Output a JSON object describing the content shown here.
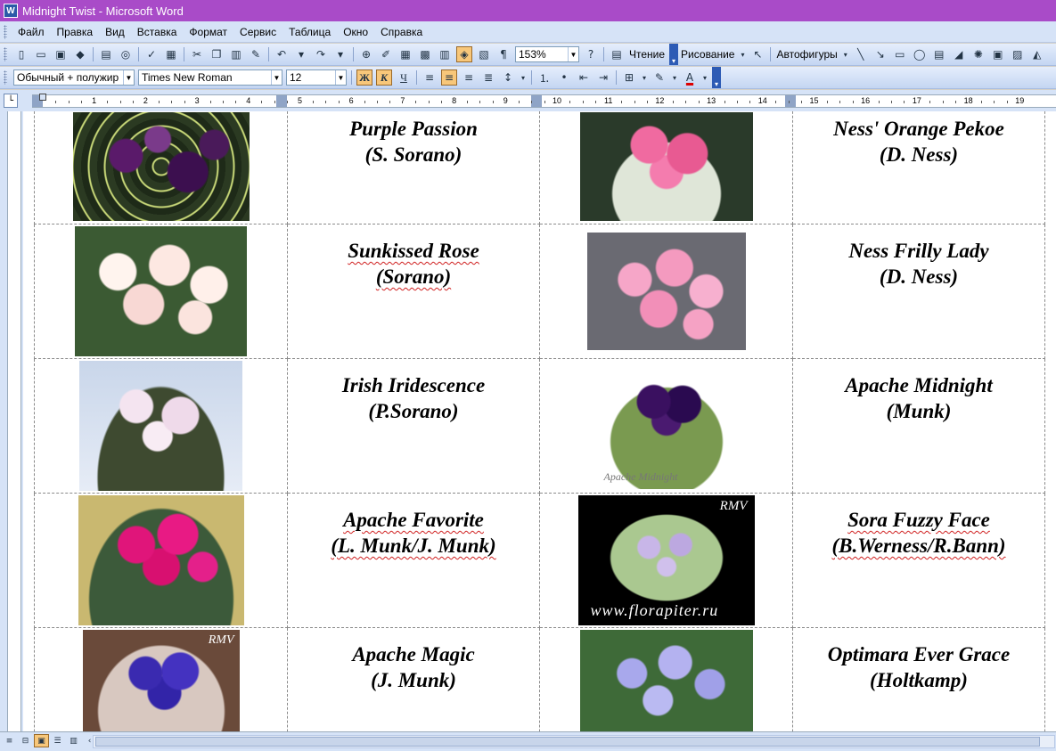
{
  "window": {
    "title": "Midnight Twist - Microsoft Word",
    "app_badge": "W"
  },
  "menu": [
    "Файл",
    "Правка",
    "Вид",
    "Вставка",
    "Формат",
    "Сервис",
    "Таблица",
    "Окно",
    "Справка"
  ],
  "standard_toolbar": {
    "zoom": "153%",
    "reading_label": "Чтение",
    "drawing_label": "Рисование",
    "autoshapes_label": "Автофигуры"
  },
  "formatting_toolbar": {
    "style": "Обычный + полужир",
    "font": "Times New Roman",
    "size": "12",
    "bold": "Ж",
    "italic": "К",
    "underline": "Ч"
  },
  "ruler": {
    "numbers": [
      "1",
      "2",
      "3",
      "4",
      "5",
      "6",
      "7",
      "8",
      "9",
      "10",
      "11",
      "12",
      "13",
      "14",
      "15",
      "16",
      "17",
      "18",
      "19"
    ]
  },
  "rows": [
    {
      "left": {
        "name": "Purple Passion",
        "author": "(S. Sorano)"
      },
      "right": {
        "name": "Ness' Orange Pekoe",
        "author": "(D. Ness)"
      }
    },
    {
      "left": {
        "name": "Sunkissed Rose",
        "author": "(Sorano)"
      },
      "right": {
        "name": "Ness Frilly Lady",
        "author": "(D. Ness)"
      }
    },
    {
      "left": {
        "name": "Irish Iridescence",
        "author": "(P.Sorano)"
      },
      "right": {
        "name": "Apache Midnight",
        "author": "(Munk)"
      }
    },
    {
      "left": {
        "name": "Apache Favorite",
        "author": "(L. Munk/J. Munk)"
      },
      "right": {
        "name": "Sora Fuzzy Face",
        "author": "(B.Werness/R.Bann)"
      }
    },
    {
      "left": {
        "name": "Apache Magic",
        "author": "(J. Munk)"
      },
      "right": {
        "name": "Optimara Ever Grace",
        "author": "(Holtkamp)"
      }
    }
  ],
  "photo_text": {
    "rmv": "RMV",
    "florapiter": "www.florapiter.ru",
    "apache_midnight": "Apache Midnight"
  },
  "colors": {
    "titlebar": "#a94bc8",
    "toolbar": "#c4d6f2",
    "spellcheck": "#d02020"
  }
}
